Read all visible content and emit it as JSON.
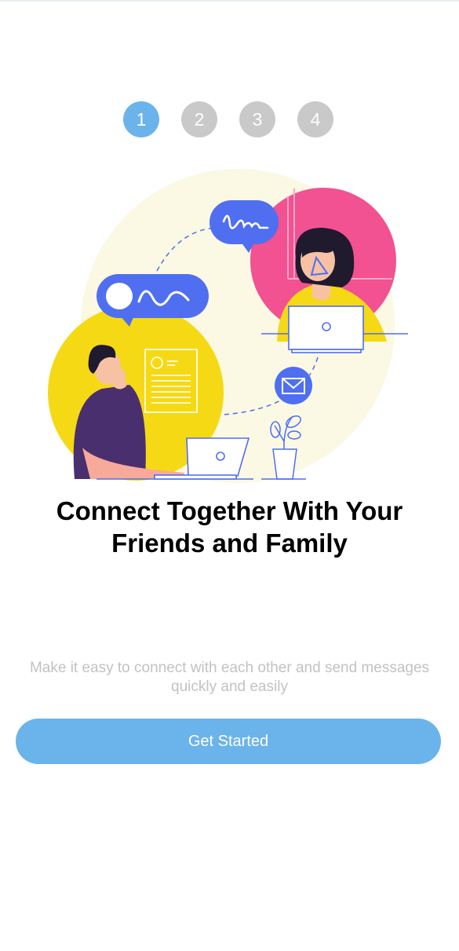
{
  "onboarding": {
    "steps": [
      {
        "label": "1",
        "active": true
      },
      {
        "label": "2",
        "active": false
      },
      {
        "label": "3",
        "active": false
      },
      {
        "label": "4",
        "active": false
      }
    ],
    "title_line1": "Connect Together With Your",
    "title_line2": "Friends and Family",
    "description_line1": "Make it easy to connect with each other and send messages",
    "description_line2": "quickly and easily",
    "button_label": "Get Started"
  },
  "colors": {
    "accent": "#6bb3eb",
    "inactive_step": "#c9c9c9",
    "title": "#000000",
    "description": "#c2c2c2",
    "illustration_yellow": "#f5d915",
    "illustration_pink": "#f25192",
    "illustration_blue": "#4f6ff0",
    "illustration_cream": "#fbf8e3"
  },
  "illustration": {
    "semantic": "two-people-chatting-illustration"
  }
}
